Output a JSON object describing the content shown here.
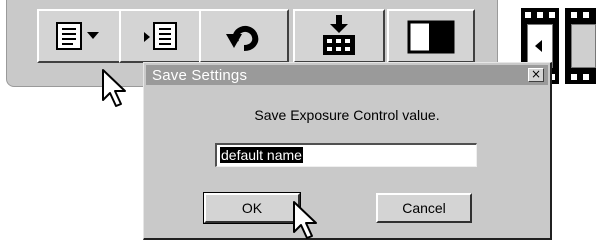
{
  "toolbar": {
    "buttons": [
      {
        "name": "save-settings-menu-button",
        "icon": "document-dropdown-icon"
      },
      {
        "name": "load-settings-button",
        "icon": "load-document-icon"
      },
      {
        "name": "undo-button",
        "icon": "undo-arrow-icon"
      },
      {
        "name": "save-image-button",
        "icon": "download-grid-icon"
      },
      {
        "name": "compare-button",
        "icon": "before-after-icon"
      }
    ]
  },
  "dialog": {
    "title": "Save Settings",
    "close_label": "×",
    "message": "Save Exposure Control value.",
    "input_value": "default name",
    "ok_label": "OK",
    "cancel_label": "Cancel"
  },
  "colors": {
    "toolbar_bg": "#c9c9c9",
    "dialog_bg": "#c9c9c9",
    "titlebar_bg": "#9a9a9a",
    "selection_bg": "#000000"
  }
}
